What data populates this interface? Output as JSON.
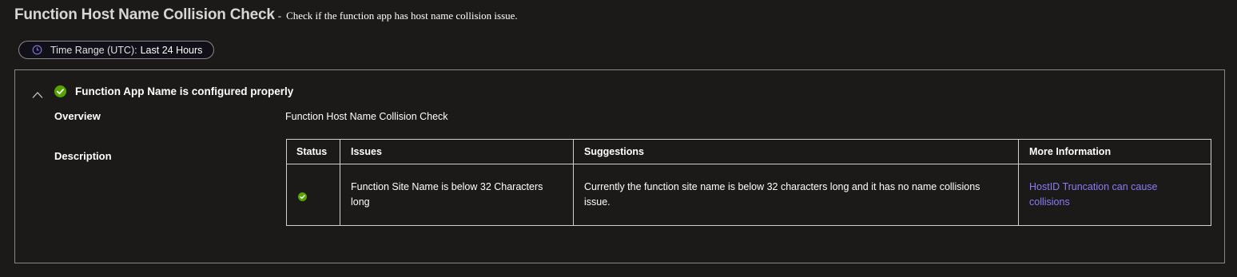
{
  "header": {
    "title": "Function Host Name Collision Check",
    "separator": "-",
    "subtitle": "Check if the function app has host name collision issue."
  },
  "time_range": {
    "label": "Time Range (UTC):",
    "value": "Last 24 Hours",
    "icon": "clock-icon"
  },
  "insight": {
    "title": "Function App Name is configured properly",
    "status": "success",
    "status_color": "#57a300",
    "overview_label": "Overview",
    "overview_value": "Function Host Name Collision Check",
    "description_label": "Description",
    "table": {
      "headers": [
        "Status",
        "Issues",
        "Suggestions",
        "More Information"
      ],
      "rows": [
        {
          "status": "success",
          "issue": "Function Site Name is below 32 Characters long",
          "suggestion": "Currently the function site name is below 32 characters long and it has no name collisions issue.",
          "more_info": "HostID Truncation can cause collisions"
        }
      ]
    }
  },
  "colors": {
    "background": "#1b1a19",
    "border": "#8a8886",
    "success": "#57a300",
    "link": "#8a7cf5",
    "time_range_icon": "#8378de"
  }
}
